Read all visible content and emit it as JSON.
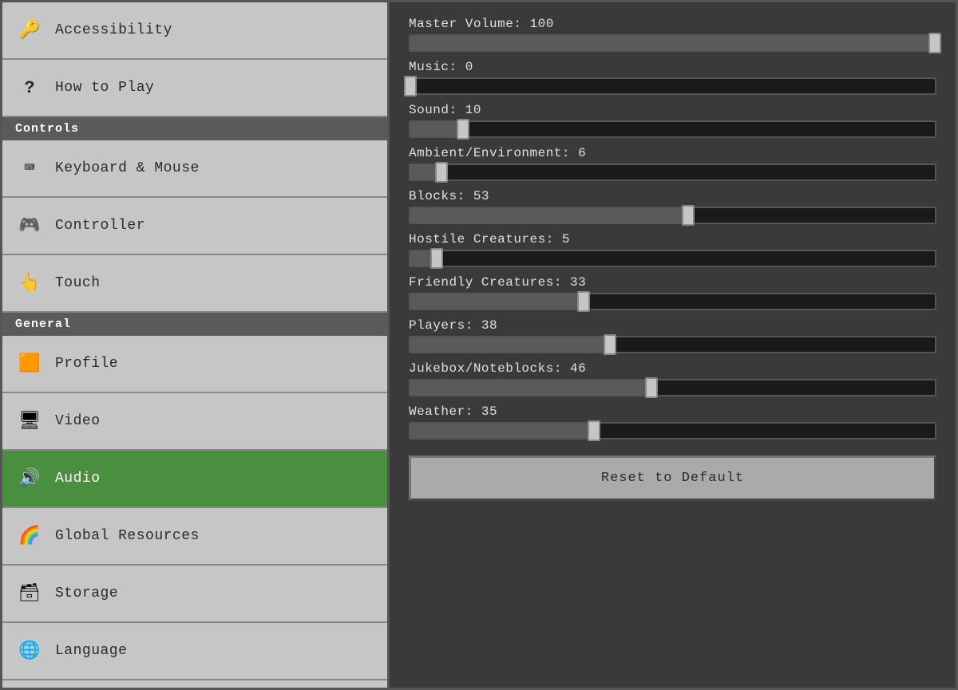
{
  "sidebar": {
    "sections": [
      {
        "type": "item",
        "name": "accessibility",
        "label": "Accessibility",
        "icon": "key",
        "active": false
      },
      {
        "type": "item",
        "name": "how-to-play",
        "label": "How to Play",
        "icon": "question",
        "active": false
      },
      {
        "type": "header",
        "label": "Controls"
      },
      {
        "type": "item",
        "name": "keyboard-mouse",
        "label": "Keyboard & Mouse",
        "icon": "keyboard",
        "active": false
      },
      {
        "type": "item",
        "name": "controller",
        "label": "Controller",
        "icon": "controller",
        "active": false
      },
      {
        "type": "item",
        "name": "touch",
        "label": "Touch",
        "icon": "touch",
        "active": false
      },
      {
        "type": "header",
        "label": "General"
      },
      {
        "type": "item",
        "name": "profile",
        "label": "Profile",
        "icon": "profile",
        "active": false
      },
      {
        "type": "item",
        "name": "video",
        "label": "Video",
        "icon": "video",
        "active": false
      },
      {
        "type": "item",
        "name": "audio",
        "label": "Audio",
        "icon": "audio",
        "active": true
      },
      {
        "type": "item",
        "name": "global-resources",
        "label": "Global Resources",
        "icon": "resources",
        "active": false
      },
      {
        "type": "item",
        "name": "storage",
        "label": "Storage",
        "icon": "storage",
        "active": false
      },
      {
        "type": "item",
        "name": "language",
        "label": "Language",
        "icon": "language",
        "active": false
      }
    ]
  },
  "main": {
    "sliders": [
      {
        "label": "Master Volume: 100",
        "value": 100
      },
      {
        "label": "Music: 0",
        "value": 0
      },
      {
        "label": "Sound: 10",
        "value": 10
      },
      {
        "label": "Ambient/Environment: 6",
        "value": 6
      },
      {
        "label": "Blocks: 53",
        "value": 53
      },
      {
        "label": "Hostile Creatures: 5",
        "value": 5
      },
      {
        "label": "Friendly Creatures: 33",
        "value": 33
      },
      {
        "label": "Players: 38",
        "value": 38
      },
      {
        "label": "Jukebox/Noteblocks: 46",
        "value": 46
      },
      {
        "label": "Weather: 35",
        "value": 35
      }
    ],
    "reset_button_label": "Reset to Default"
  }
}
